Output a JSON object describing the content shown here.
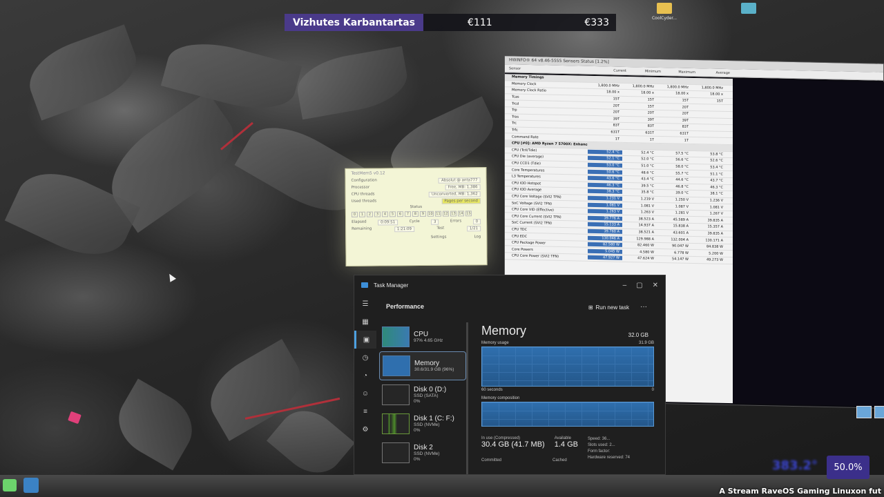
{
  "overlay": {
    "name": "Vizhutes Karbantartas",
    "price_a": "€111",
    "price_b": "€333"
  },
  "desktop": {
    "icons": [
      {
        "label": "CoolCyder...",
        "icon": "folder-icon"
      },
      {
        "label": "",
        "icon": "folder-icon"
      }
    ]
  },
  "hwinfo": {
    "title": "HWiNFO® 64 v8.46-5555 Sensors Status [1.2%]",
    "columns": [
      "Sensor",
      "Current",
      "Minimum",
      "Maximum",
      "Average"
    ],
    "rows": [
      {
        "name": "Memory Timings",
        "section": true,
        "values": [
          "",
          "",
          "",
          ""
        ]
      },
      {
        "name": "Memory Clock",
        "values": [
          "1,800.0 MHz",
          "1,800.0 MHz",
          "1,800.0 MHz",
          "1,800.0 MHz"
        ]
      },
      {
        "name": "Memory Clock Ratio",
        "values": [
          "18.00 x",
          "18.00 x",
          "18.00 x",
          "18.00 x"
        ]
      },
      {
        "name": "Tcas",
        "values": [
          "15T",
          "15T",
          "15T",
          "15T"
        ]
      },
      {
        "name": "Trcd",
        "values": [
          "20T",
          "15T",
          "20T",
          ""
        ]
      },
      {
        "name": "Trp",
        "values": [
          "20T",
          "20T",
          "20T",
          ""
        ]
      },
      {
        "name": "Tras",
        "values": [
          "39T",
          "39T",
          "39T",
          ""
        ]
      },
      {
        "name": "Trc",
        "values": [
          "83T",
          "83T",
          "83T",
          ""
        ]
      },
      {
        "name": "Trfc",
        "values": [
          "631T",
          "631T",
          "631T",
          ""
        ]
      },
      {
        "name": "Command Rate",
        "values": [
          "1T",
          "1T",
          "1T",
          ""
        ]
      },
      {
        "name": "CPU [#0]: AMD Ryzen 7 5700X: Enhanced",
        "section": true,
        "values": [
          "",
          "",
          "",
          ""
        ]
      },
      {
        "name": "CPU (Tctl/Tdie)",
        "values": [
          "52.4 °C",
          "52.4 °C",
          "57.5 °C",
          "53.8 °C"
        ]
      },
      {
        "name": "CPU Die (average)",
        "values": [
          "52.1 °C",
          "52.0 °C",
          "56.6 °C",
          "52.6 °C"
        ]
      },
      {
        "name": "CPU CCD1 (Tdie)",
        "values": [
          "53.0 °C",
          "51.0 °C",
          "58.0 °C",
          "53.4 °C"
        ]
      },
      {
        "name": "Core Temperatures",
        "values": [
          "50.6 °C",
          "48.6 °C",
          "55.7 °C",
          "51.1 °C"
        ]
      },
      {
        "name": "L3 Temperatures",
        "values": [
          "43.6 °C",
          "43.4 °C",
          "44.6 °C",
          "43.7 °C"
        ]
      },
      {
        "name": "CPU IOD Hotspot",
        "values": [
          "46.3 °C",
          "39.5 °C",
          "46.8 °C",
          "46.3 °C"
        ]
      },
      {
        "name": "CPU IOD Average",
        "values": [
          "38.3 °C",
          "35.8 °C",
          "39.0 °C",
          "38.1 °C"
        ]
      },
      {
        "name": "CPU Core Voltage (SVI2 TFN)",
        "values": [
          "1.231 V",
          "1.219 V",
          "1.250 V",
          "1.236 V"
        ]
      },
      {
        "name": "SoC Voltage (SVI2 TFN)",
        "values": [
          "1.081 V",
          "1.081 V",
          "1.087 V",
          "1.081 V"
        ]
      },
      {
        "name": "CPU Core VID (Effective)",
        "values": [
          "1.263 V",
          "1.263 V",
          "1.281 V",
          "1.267 V"
        ]
      },
      {
        "name": "CPU Core Current (SVI2 TFN)",
        "values": [
          "39.776 A",
          "38.523 A",
          "45.589 A",
          "39.835 A"
        ]
      },
      {
        "name": "SoC Current (SVI2 TFN)",
        "values": [
          "15.133 A",
          "14.937 A",
          "15.838 A",
          "15.357 A"
        ]
      },
      {
        "name": "CPU TDC",
        "values": [
          "39.760 A",
          "38.521 A",
          "43.601 A",
          "39.835 A"
        ]
      },
      {
        "name": "CPU EDC",
        "values": [
          "130.046 A",
          "129.988 A",
          "132.004 A",
          "130.171 A"
        ]
      },
      {
        "name": "CPU Package Power",
        "values": [
          "82.580 W",
          "82.460 W",
          "90.047 W",
          "84.838 W"
        ]
      },
      {
        "name": "Core Powers",
        "values": [
          "5.045 W",
          "4.580 W",
          "6.778 W",
          "5.200 W"
        ]
      },
      {
        "name": "CPU Core Power (SVI2 TFN)",
        "values": [
          "47.927 W",
          "47.624 W",
          "54.147 W",
          "49.273 W"
        ]
      }
    ]
  },
  "testmem": {
    "title": "TestMem5 v0.12",
    "rows": [
      {
        "label": "Configuration",
        "value": "Absolut @ anta777"
      },
      {
        "label": "Processor",
        "value": "Free, MB: 1,386"
      },
      {
        "label": "CPU threads",
        "value": "Unconverted, MB: 1,362"
      },
      {
        "label": "Used threads",
        "value": "Pages per second"
      }
    ],
    "status_label": "Status",
    "status_cells": [
      "0",
      "1",
      "2",
      "3",
      "4",
      "5",
      "6",
      "7",
      "8",
      "9",
      "10",
      "11",
      "12",
      "13",
      "14",
      "15"
    ],
    "elapsed_label": "Elapsed",
    "elapsed_value": "0:09:51",
    "cycle_label": "Cycle",
    "cycle_value": "3",
    "errors_label": "Errors",
    "errors_value": "0",
    "remaining_label": "Remaining",
    "remaining_value": "1:21:09",
    "test_label": "Test",
    "test_value": "1/21",
    "settings_label": "Settings",
    "log_label": "Log"
  },
  "taskmanager": {
    "title": "Task Manager",
    "section": "Performance",
    "run_new_task": "Run new task",
    "items": [
      {
        "name": "CPU",
        "sub1": "97% 4.65 GHz",
        "sub2": "",
        "sub3": ""
      },
      {
        "name": "Memory",
        "sub1": "30.6/31.9 GB (96%)",
        "sub2": "",
        "sub3": ""
      },
      {
        "name": "Disk 0 (D:)",
        "sub1": "SSD (SATA)",
        "sub2": "0%",
        "sub3": ""
      },
      {
        "name": "Disk 1 (C: F:)",
        "sub1": "SSD (NVMe)",
        "sub2": "0%",
        "sub3": ""
      },
      {
        "name": "Disk 2",
        "sub1": "SSD (NVMe)",
        "sub2": "0%",
        "sub3": ""
      }
    ],
    "main_title": "Memory",
    "total": "32.0 GB",
    "usage_label": "Memory usage",
    "usage_max": "31.9 GB",
    "time_label": "60 seconds",
    "time_zero": "0",
    "composition_label": "Memory composition",
    "in_use_label": "In use (Compressed)",
    "in_use_value": "30.4 GB (41.7 MB)",
    "available_label": "Available",
    "available_value": "1.4 GB",
    "committed_label": "Committed",
    "cached_label": "Cached",
    "speed_label": "Speed:",
    "speed_value": "36...",
    "slots_label": "Slots used:",
    "slots_value": "2...",
    "form_label": "Form factor:",
    "hw_reserved_label": "Hardware reserved:",
    "hw_reserved_value": "74",
    "memory_usage_fraction": 0.96
  },
  "taskbar": {
    "percent": "50.0%",
    "blurred_number": "383.2°"
  },
  "watermark": "A Stream RaveOS Gaming Linuxon fut"
}
